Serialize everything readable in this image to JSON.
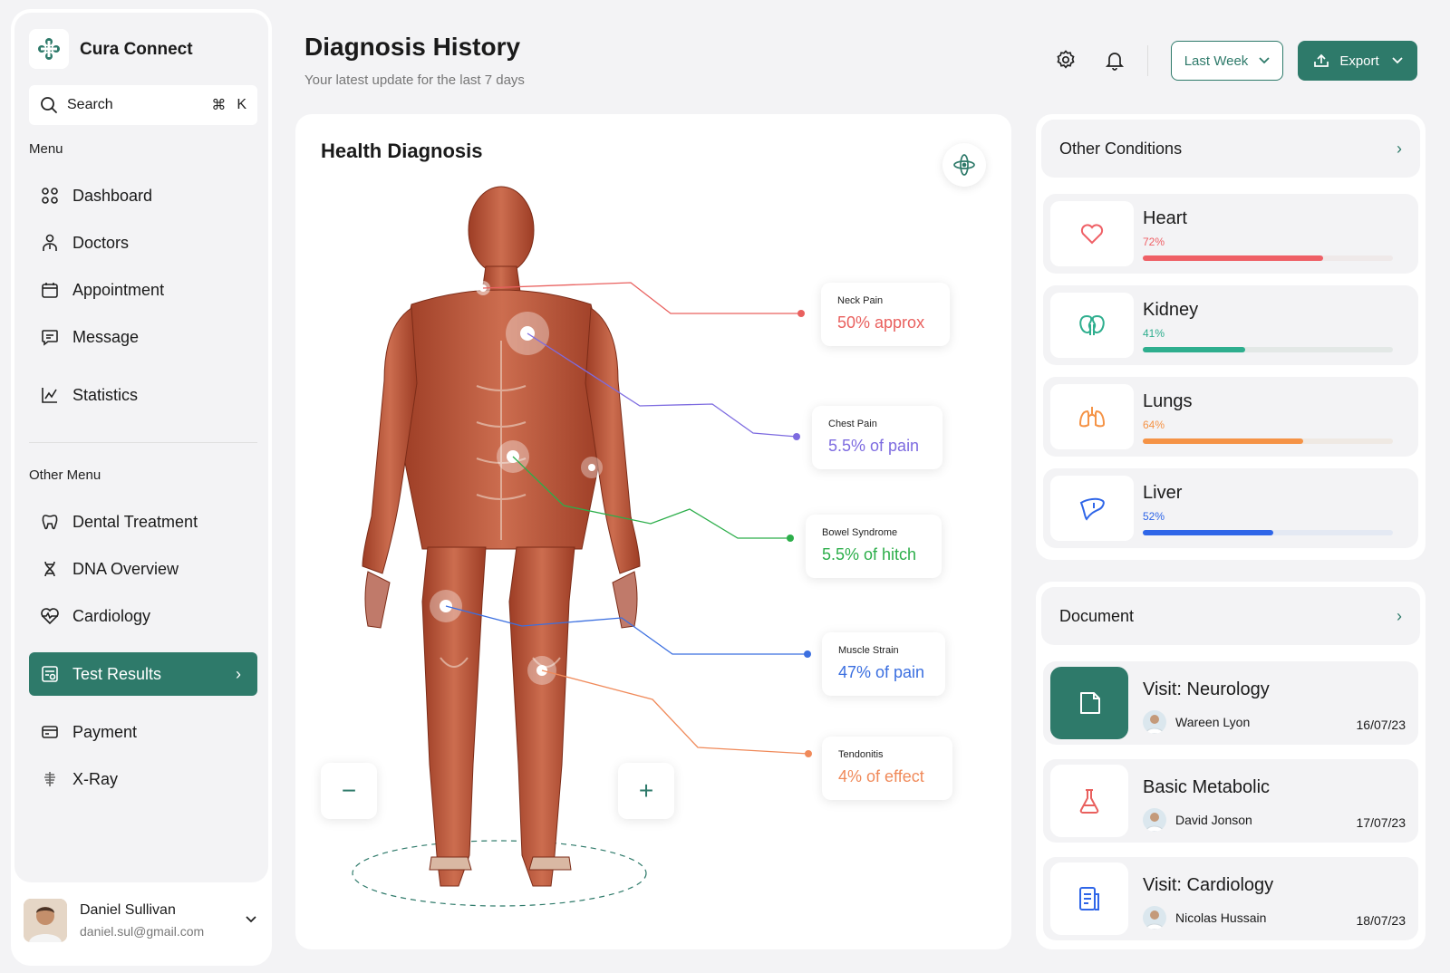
{
  "app": {
    "name": "Cura Connect"
  },
  "search": {
    "label": "Search",
    "shortcut_cmd": "⌘",
    "shortcut_key": "K"
  },
  "menu": {
    "title": "Menu",
    "items": [
      {
        "label": "Dashboard",
        "icon": "grid-icon"
      },
      {
        "label": "Doctors",
        "icon": "doctor-icon"
      },
      {
        "label": "Appointment",
        "icon": "calendar-icon"
      },
      {
        "label": "Message",
        "icon": "message-icon"
      },
      {
        "label": "Statistics",
        "icon": "chart-icon"
      }
    ]
  },
  "other_menu": {
    "title": "Other Menu",
    "items": [
      {
        "label": "Dental Treatment",
        "icon": "tooth-icon"
      },
      {
        "label": "DNA Overview",
        "icon": "dna-icon"
      },
      {
        "label": "Cardiology",
        "icon": "heart-pulse-icon"
      },
      {
        "label": "Test Results",
        "icon": "test-results-icon",
        "active": true
      },
      {
        "label": "Payment",
        "icon": "payment-icon"
      },
      {
        "label": "X-Ray",
        "icon": "xray-icon"
      }
    ]
  },
  "user": {
    "name": "Daniel Sullivan",
    "email": "daniel.sul@gmail.com"
  },
  "header": {
    "title": "Diagnosis History",
    "subtitle": "Your latest update for the last 7 days",
    "period": "Last Week",
    "export": "Export"
  },
  "diagnosis": {
    "title": "Health Diagnosis",
    "zoom_out": "−",
    "zoom_in": "+",
    "tags": [
      {
        "label": "Neck Pain",
        "value": "50% approx",
        "color": "#e9605e"
      },
      {
        "label": "Chest Pain",
        "value": "5.5% of pain",
        "color": "#7d6be0"
      },
      {
        "label": "Bowel Syndrome",
        "value": "5.5% of hitch",
        "color": "#2cae4a"
      },
      {
        "label": "Muscle Strain",
        "value": "47% of pain",
        "color": "#3b6fe0"
      },
      {
        "label": "Tendonitis",
        "value": "4% of effect",
        "color": "#f08a5a"
      }
    ]
  },
  "other_conditions": {
    "title": "Other Conditions",
    "items": [
      {
        "name": "Heart",
        "percent_label": "72%",
        "percent": 0.72,
        "color": "#ef6066",
        "track": "#efe9e9",
        "icon": "heart-icon"
      },
      {
        "name": "Kidney",
        "percent_label": "41%",
        "percent": 0.41,
        "color": "#2eae8e",
        "track": "#e3e8e6",
        "icon": "kidney-icon"
      },
      {
        "name": "Lungs",
        "percent_label": "64%",
        "percent": 0.64,
        "color": "#f59346",
        "track": "#efe9e3",
        "icon": "lungs-icon"
      },
      {
        "name": "Liver",
        "percent_label": "52%",
        "percent": 0.52,
        "color": "#2f66e8",
        "track": "#e4e9f3",
        "icon": "liver-icon"
      }
    ]
  },
  "documents": {
    "title": "Document",
    "items": [
      {
        "title": "Visit: Neurology",
        "person": "Wareen Lyon",
        "date": "16/07/23",
        "icon": "document-icon",
        "active": true
      },
      {
        "title": "Basic Metabolic",
        "person": "David Jonson",
        "date": "17/07/23",
        "icon": "flask-icon"
      },
      {
        "title": "Visit: Cardiology",
        "person": "Nicolas Hussain",
        "date": "18/07/23",
        "icon": "report-icon"
      }
    ]
  },
  "colors": {
    "primary": "#2e7a6a",
    "background": "#f3f3f5"
  }
}
